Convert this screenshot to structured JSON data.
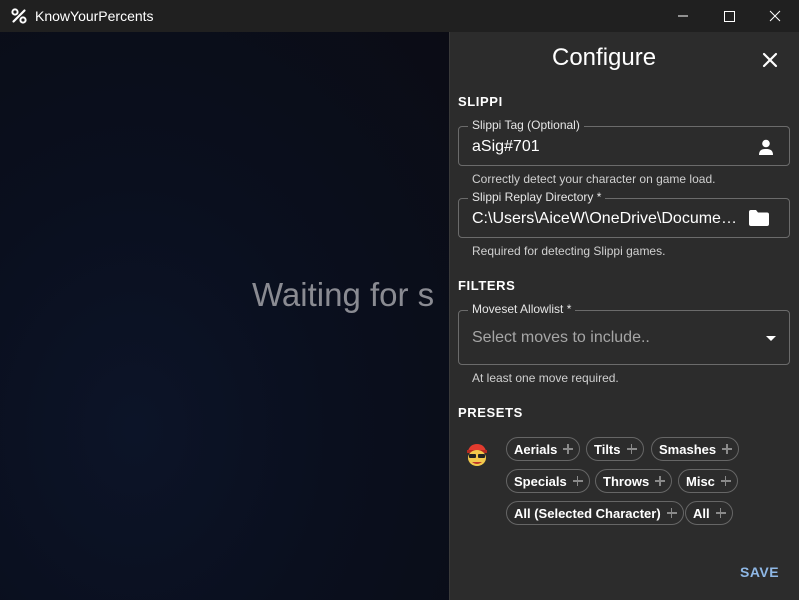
{
  "window": {
    "title": "KnowYourPercents"
  },
  "main": {
    "waiting_text": "Waiting for s"
  },
  "drawer": {
    "title": "Configure",
    "slippi": {
      "section": "SLIPPI",
      "tag": {
        "label": "Slippi Tag (Optional)",
        "value": "aSig#701",
        "helper": "Correctly detect your character on game load."
      },
      "replay_dir": {
        "label": "Slippi Replay Directory *",
        "value": "C:\\Users\\AiceW\\OneDrive\\Documents\\Slippi",
        "helper": "Required for detecting Slippi games."
      }
    },
    "filters": {
      "section": "FILTERS",
      "allowlist": {
        "label": "Moveset Allowlist *",
        "placeholder": "Select moves to include..",
        "helper": "At least one move required."
      }
    },
    "presets": {
      "section": "PRESETS",
      "chips": [
        "Aerials",
        "Tilts",
        "Smashes",
        "Specials",
        "Throws",
        "Misc",
        "All (Selected Character)",
        "All"
      ]
    },
    "save_label": "SAVE"
  },
  "colors": {
    "accent": "#8fb8e6",
    "drawer_bg": "#2c2c2c",
    "titlebar_bg": "#202020"
  },
  "icons": [
    "app-icon",
    "minimize-icon",
    "maximize-icon",
    "close-icon",
    "user-icon",
    "folder-icon",
    "dropdown-arrow-icon",
    "plus-icon",
    "character-avatar-icon"
  ]
}
